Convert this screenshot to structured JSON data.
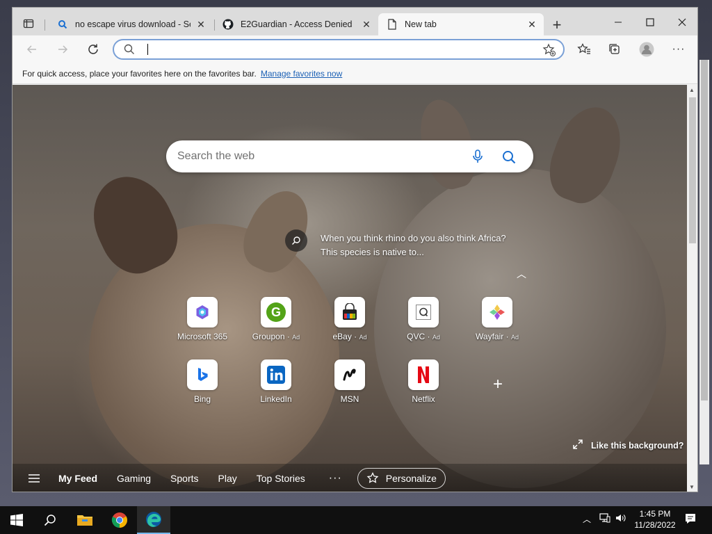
{
  "tabs": [
    {
      "title": "no escape virus download - Sear",
      "favicon": "search-icon",
      "active": false
    },
    {
      "title": "E2Guardian - Access Denied",
      "favicon": "github-icon",
      "active": false
    },
    {
      "title": "New tab",
      "favicon": "page-icon",
      "active": true
    }
  ],
  "address_bar": {
    "value": "",
    "placeholder": ""
  },
  "favorites_bar": {
    "hint": "For quick access, place your favorites here on the favorites bar.",
    "link": "Manage favorites now"
  },
  "newtab": {
    "search_placeholder": "Search the web",
    "fact": "When you think rhino do you also think Africa? This species is native to...",
    "like_background": "Like this background?",
    "tiles_row1": [
      {
        "label": "Microsoft 365",
        "ad": ""
      },
      {
        "label": "Groupon",
        "ad": "Ad"
      },
      {
        "label": "eBay",
        "ad": "Ad"
      },
      {
        "label": "QVC",
        "ad": "Ad"
      },
      {
        "label": "Wayfair",
        "ad": "Ad"
      }
    ],
    "tiles_row2": [
      {
        "label": "Bing",
        "ad": ""
      },
      {
        "label": "LinkedIn",
        "ad": ""
      },
      {
        "label": "MSN",
        "ad": ""
      },
      {
        "label": "Netflix",
        "ad": ""
      }
    ],
    "feed_tabs": [
      "My Feed",
      "Gaming",
      "Sports",
      "Play",
      "Top Stories"
    ],
    "more": "···",
    "personalize": "Personalize"
  },
  "taskbar": {
    "time": "1:45 PM",
    "date": "11/28/2022"
  },
  "colors": {
    "accent": "#0078d4",
    "netflix": "#e50914",
    "linkedin": "#0a66c2"
  }
}
